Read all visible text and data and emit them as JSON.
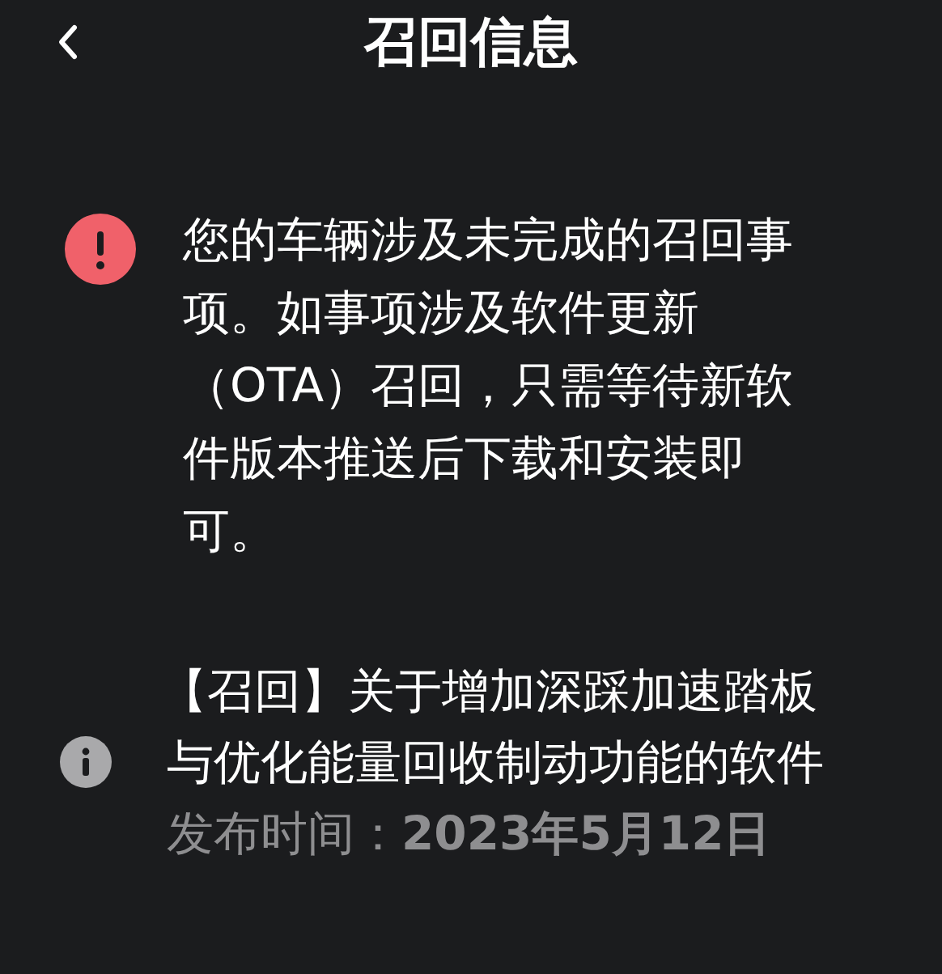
{
  "header": {
    "title": "召回信息"
  },
  "notice": {
    "kind": "warning",
    "text": "您的车辆涉及未完成的召回事项。如事项涉及软件更新（OTA）召回，只需等待新软件版本推送后下载和安装即可。"
  },
  "recalls": [
    {
      "kind": "info",
      "title_lines": [
        "【召回】关于增加深踩加速踏板",
        "与优化能量回收制动功能的软件"
      ],
      "date_label": "发布时间：",
      "date": "2023年5月12日"
    }
  ]
}
